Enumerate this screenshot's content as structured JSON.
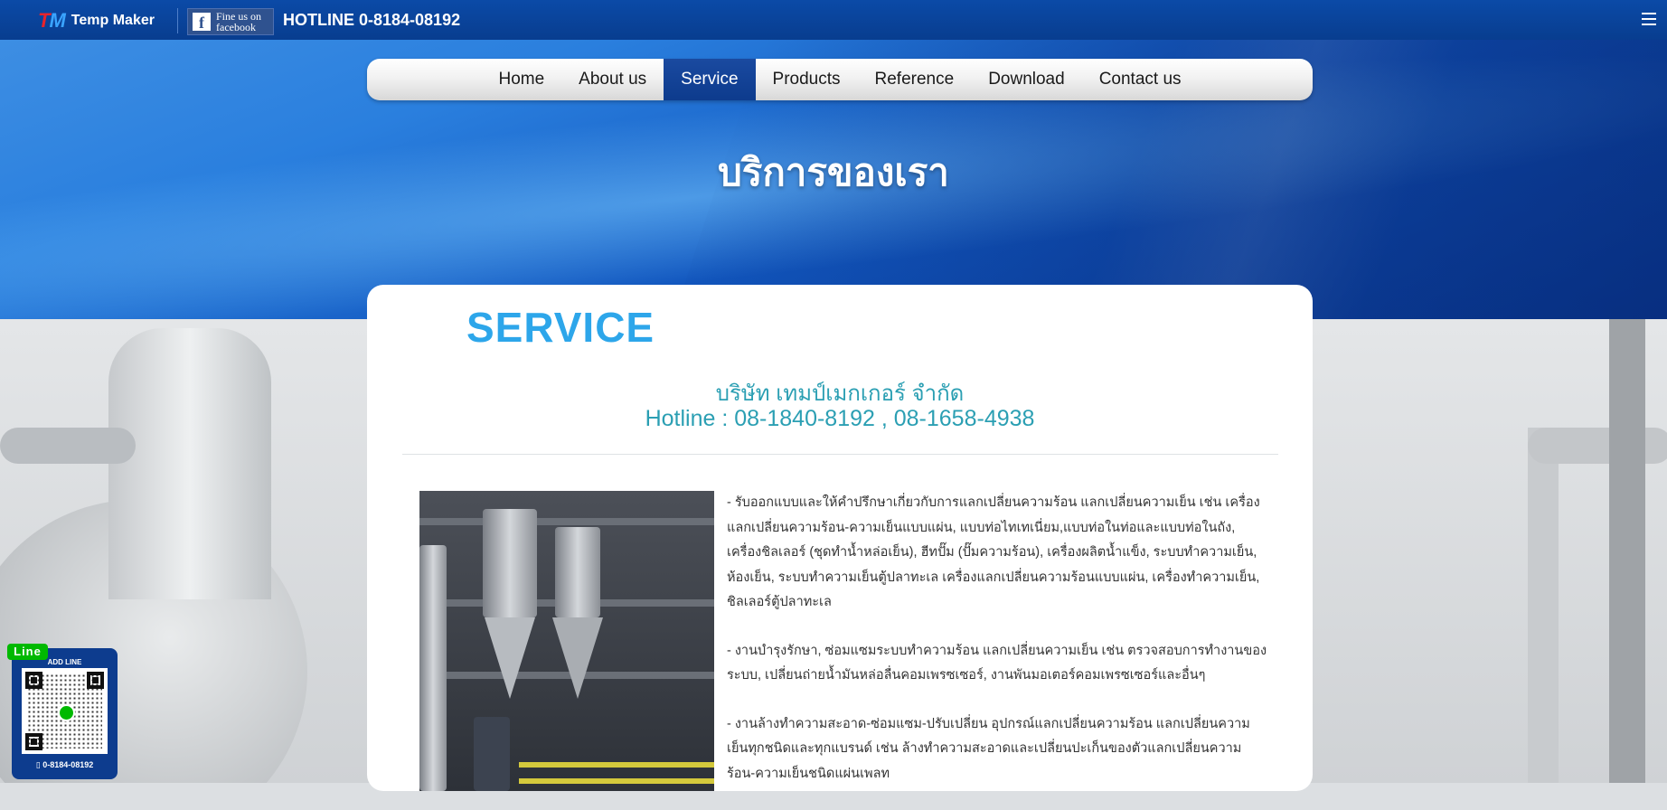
{
  "topbar": {
    "logo_mark_t": "T",
    "logo_mark_m": "M",
    "logo_text": "Temp Maker",
    "facebook_line1": "Fine us on",
    "facebook_line2": "facebook",
    "hotline": "HOTLINE 0-8184-08192"
  },
  "nav": {
    "items": [
      {
        "label": "Home"
      },
      {
        "label": "About us"
      },
      {
        "label": "Service",
        "active": true
      },
      {
        "label": "Products"
      },
      {
        "label": "Reference"
      },
      {
        "label": "Download"
      },
      {
        "label": "Contact us"
      }
    ]
  },
  "hero": {
    "title": "บริการของเรา"
  },
  "content": {
    "section_title": "SERVICE",
    "company": "บริษัท เทมป์เมกเกอร์ จำกัด",
    "hotline": "Hotline : 08-1840-8192 , 08-1658-4938",
    "paragraphs": [
      "- รับออกแบบและให้คำปรึกษาเกี่ยวกับการแลกเปลี่ยนความร้อน แลกเปลี่ยนความเย็น เช่น เครื่องแลกเปลี่ยนความร้อน-ความเย็นแบบแผ่น, แบบท่อไทเทเนี่ยม,แบบท่อในท่อและแบบท่อในถัง, เครื่องชิลเลอร์ (ชุดทำน้ำหล่อเย็น), ฮีทปั๊ม (ปั๊มความร้อน), เครื่องผลิตน้ำแข็ง, ระบบทำความเย็น, ห้องเย็น, ระบบทำความเย็นตู้ปลาทะเล เครื่องแลกเปลี่ยนความร้อนแบบแผ่น, เครื่องทำความเย็น, ชิลเลอร์ตู้ปลาทะเล",
      "- งานบำรุงรักษา, ซ่อมแซมระบบทำความร้อน แลกเปลี่ยนความเย็น เช่น ตรวจสอบการทำงานของระบบ, เปลี่ยนถ่ายน้ำมันหล่อลื่นคอมเพรซเซอร์, งานพันมอเตอร์คอมเพรซเซอร์และอื่นๆ",
      "- งานล้างทำความสะอาด-ซ่อมแซม-ปรับเปลี่ยน อุปกรณ์แลกเปลี่ยนความร้อน แลกเปลี่ยนความเย็นทุกชนิดและทุกแบรนด์ เช่น ล้างทำความสะอาดและเปลี่ยนปะเก็นของตัวแลกเปลี่ยนความร้อน-ความเย็นชนิดแผ่นเพลท"
    ]
  },
  "line_widget": {
    "tag": "Line",
    "add_label": "ADD LINE",
    "phone": "0-8184-08192"
  },
  "icons": {
    "menu": "hamburger-menu-icon",
    "facebook": "facebook-icon",
    "qr": "qr-code-icon"
  }
}
